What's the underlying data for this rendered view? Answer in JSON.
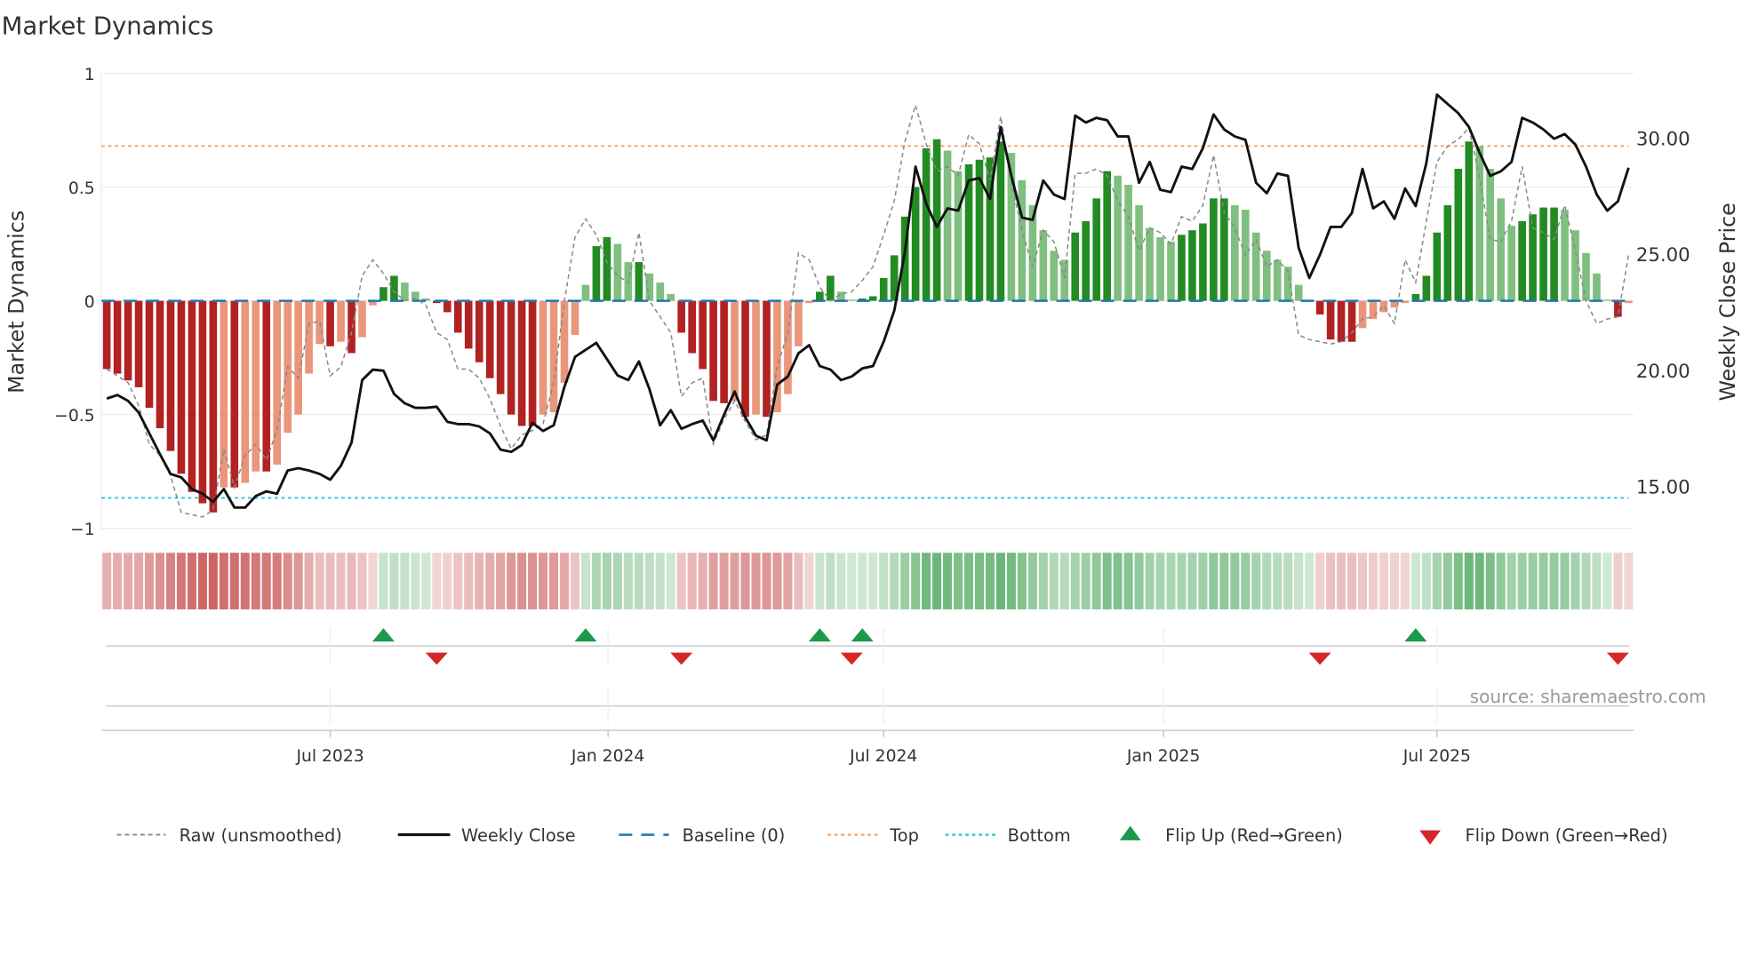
{
  "chart_data": {
    "type": "bar",
    "title": "Market Dynamics",
    "ylabel": "Market Dynamics",
    "y2label": "Weekly Close Price",
    "ylim": [
      -1,
      1
    ],
    "y2lim": [
      12.8,
      32.7
    ],
    "yticks": [
      {
        "v": 1,
        "label": "1"
      },
      {
        "v": 0.5,
        "label": "0.5"
      },
      {
        "v": 0,
        "label": "0"
      },
      {
        "v": -0.5,
        "label": "−0.5"
      },
      {
        "v": -1,
        "label": "−1"
      }
    ],
    "y2ticks": [
      {
        "v": 30,
        "label": "30.00"
      },
      {
        "v": 25,
        "label": "25.00"
      },
      {
        "v": 20,
        "label": "20.00"
      },
      {
        "v": 15,
        "label": "15.00"
      }
    ],
    "xticks": [
      {
        "week": 21.5,
        "label": "Jul 2023"
      },
      {
        "week": 47.6,
        "label": "Jan 2024"
      },
      {
        "week": 73.5,
        "label": "Jul 2024"
      },
      {
        "week": 99.8,
        "label": "Jan 2025"
      },
      {
        "week": 125.5,
        "label": "Jul 2025"
      }
    ],
    "top_level": 0.68,
    "bottom_level": -0.866,
    "baseline": 0,
    "market_dynamics": [
      -0.3,
      -0.32,
      -0.35,
      -0.38,
      -0.47,
      -0.56,
      -0.66,
      -0.76,
      -0.84,
      -0.89,
      -0.93,
      -0.82,
      -0.82,
      -0.8,
      -0.75,
      -0.75,
      -0.72,
      -0.58,
      -0.5,
      -0.32,
      -0.19,
      -0.2,
      -0.18,
      -0.23,
      -0.16,
      -0.02,
      0.06,
      0.11,
      0.08,
      0.04,
      0.01,
      -0.01,
      -0.05,
      -0.14,
      -0.21,
      -0.27,
      -0.34,
      -0.41,
      -0.5,
      -0.55,
      -0.55,
      -0.5,
      -0.49,
      -0.36,
      -0.15,
      0.07,
      0.24,
      0.28,
      0.25,
      0.17,
      0.17,
      0.12,
      0.08,
      0.03,
      -0.14,
      -0.23,
      -0.3,
      -0.44,
      -0.45,
      -0.44,
      -0.51,
      -0.5,
      -0.51,
      -0.49,
      -0.41,
      -0.2,
      -0.01,
      0.04,
      0.11,
      0.04,
      0.005,
      0.01,
      0.02,
      0.1,
      0.2,
      0.37,
      0.5,
      0.67,
      0.71,
      0.66,
      0.57,
      0.6,
      0.62,
      0.63,
      0.7,
      0.65,
      0.53,
      0.42,
      0.31,
      0.22,
      0.18,
      0.3,
      0.35,
      0.45,
      0.57,
      0.55,
      0.51,
      0.42,
      0.32,
      0.28,
      0.26,
      0.29,
      0.31,
      0.34,
      0.45,
      0.45,
      0.42,
      0.4,
      0.3,
      0.22,
      0.18,
      0.15,
      0.07,
      0.005,
      -0.06,
      -0.17,
      -0.18,
      -0.18,
      -0.12,
      -0.08,
      -0.05,
      -0.03,
      -0.01,
      0.03,
      0.11,
      0.3,
      0.42,
      0.58,
      0.7,
      0.68,
      0.58,
      0.45,
      0.33,
      0.35,
      0.38,
      0.41,
      0.41,
      0.4,
      0.31,
      0.21,
      0.12,
      0.005,
      -0.07,
      -0.01
    ],
    "raw_unsmoothed": [
      -0.3,
      -0.33,
      -0.36,
      -0.46,
      -0.63,
      -0.68,
      -0.77,
      -0.93,
      -0.94,
      -0.95,
      -0.92,
      -0.65,
      -0.82,
      -0.68,
      -0.63,
      -0.7,
      -0.57,
      -0.29,
      -0.34,
      -0.1,
      -0.09,
      -0.33,
      -0.29,
      -0.14,
      0.11,
      0.18,
      0.12,
      0.04,
      0.0,
      0.01,
      -0.02,
      -0.14,
      -0.17,
      -0.3,
      -0.3,
      -0.34,
      -0.43,
      -0.55,
      -0.65,
      -0.59,
      -0.57,
      -0.54,
      -0.36,
      0.0,
      0.28,
      0.36,
      0.29,
      0.17,
      0.11,
      0.08,
      0.3,
      0.0,
      -0.07,
      -0.14,
      -0.42,
      -0.36,
      -0.34,
      -0.63,
      -0.52,
      -0.44,
      -0.53,
      -0.61,
      -0.59,
      -0.29,
      -0.14,
      0.21,
      0.18,
      0.06,
      0.0,
      0.03,
      0.04,
      0.09,
      0.15,
      0.29,
      0.44,
      0.7,
      0.86,
      0.69,
      0.57,
      0.59,
      0.55,
      0.73,
      0.69,
      0.53,
      0.81,
      0.52,
      0.31,
      0.15,
      0.31,
      0.26,
      0.1,
      0.56,
      0.56,
      0.58,
      0.55,
      0.44,
      0.37,
      0.22,
      0.32,
      0.3,
      0.25,
      0.37,
      0.35,
      0.42,
      0.64,
      0.39,
      0.32,
      0.2,
      0.27,
      0.15,
      0.18,
      0.13,
      -0.15,
      -0.17,
      -0.18,
      -0.19,
      -0.18,
      -0.14,
      -0.08,
      -0.07,
      -0.02,
      -0.1,
      0.18,
      0.08,
      0.35,
      0.61,
      0.68,
      0.71,
      0.76,
      0.54,
      0.27,
      0.26,
      0.35,
      0.59,
      0.32,
      0.3,
      0.27,
      0.42,
      0.22,
      0.0,
      -0.1,
      -0.08,
      -0.07,
      0.2
    ],
    "weekly_close": [
      18.8,
      18.95,
      18.7,
      18.2,
      17.3,
      16.4,
      15.55,
      15.4,
      14.9,
      14.7,
      14.35,
      14.9,
      14.1,
      14.1,
      14.6,
      14.8,
      14.7,
      15.7,
      15.8,
      15.7,
      15.55,
      15.3,
      15.9,
      16.9,
      19.6,
      20.05,
      20.0,
      19.0,
      18.6,
      18.4,
      18.4,
      18.45,
      17.8,
      17.7,
      17.7,
      17.6,
      17.3,
      16.6,
      16.5,
      16.8,
      17.75,
      17.4,
      17.65,
      19.3,
      20.6,
      20.9,
      21.2,
      20.5,
      19.8,
      19.6,
      20.4,
      19.2,
      17.65,
      18.3,
      17.5,
      17.7,
      17.85,
      17.0,
      18.1,
      19.1,
      18.0,
      17.2,
      17.0,
      19.4,
      19.75,
      20.75,
      21.1,
      20.2,
      20.05,
      19.6,
      19.75,
      20.1,
      20.2,
      21.25,
      22.6,
      25.1,
      28.8,
      27.2,
      26.2,
      27.0,
      26.9,
      28.2,
      28.3,
      27.4,
      30.5,
      28.4,
      26.6,
      26.5,
      28.2,
      27.6,
      27.4,
      31.0,
      30.7,
      30.9,
      30.8,
      30.1,
      30.1,
      28.1,
      29.0,
      27.8,
      27.7,
      28.8,
      28.7,
      29.6,
      31.05,
      30.4,
      30.1,
      29.95,
      28.1,
      27.65,
      28.5,
      28.4,
      25.3,
      24.0,
      25.0,
      26.2,
      26.2,
      26.8,
      28.7,
      27.0,
      27.3,
      26.55,
      27.85,
      27.1,
      28.95,
      31.9,
      31.5,
      31.1,
      30.5,
      29.4,
      28.4,
      28.6,
      29.0,
      30.9,
      30.7,
      30.4,
      30.0,
      30.2,
      29.75,
      28.8,
      27.6,
      26.9,
      27.3,
      28.75
    ],
    "flip_up_weeks": [
      26,
      45,
      67,
      71,
      123
    ],
    "flip_down_weeks": [
      31,
      54,
      70,
      114,
      142
    ],
    "colors": {
      "strong_red": "#b22222",
      "weak_red": "#e9967a",
      "strong_green": "#228b22",
      "weak_green": "#7fbf7f",
      "close": "#111111",
      "raw": "#888888",
      "baseline": "#1f77b4",
      "top": "#f4a261",
      "bottom": "#22c5d6",
      "flip_up": "#1a9a4a",
      "flip_down": "#d62728"
    },
    "legend": {
      "raw": "Raw (unsmoothed)",
      "close": "Weekly Close",
      "baseline": "Baseline (0)",
      "top": "Top",
      "bottom": "Bottom",
      "flip_up": "Flip Up (Red→Green)",
      "flip_down": "Flip Down (Green→Red)"
    },
    "legend_placement": "bottom",
    "source": "source: sharemaestro.com"
  }
}
